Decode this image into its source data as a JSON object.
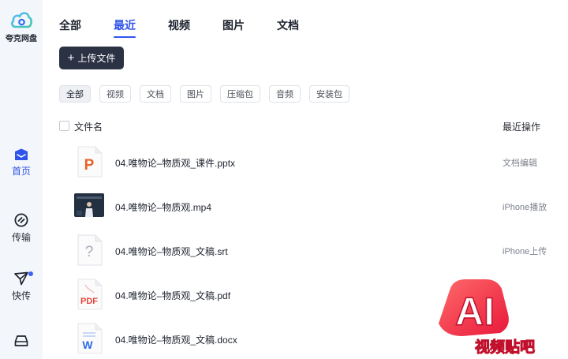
{
  "app": {
    "name": "夸克网盘"
  },
  "sidebar": {
    "items": [
      {
        "label": "首页",
        "icon": "home-icon",
        "active": true
      },
      {
        "label": "传输",
        "icon": "transfer-icon",
        "active": false
      },
      {
        "label": "快传",
        "icon": "send-icon",
        "active": false,
        "badge_dot": true
      },
      {
        "label": "",
        "icon": "inbox-icon",
        "active": false
      }
    ]
  },
  "tabs": [
    {
      "label": "全部",
      "active": false
    },
    {
      "label": "最近",
      "active": true
    },
    {
      "label": "视频",
      "active": false
    },
    {
      "label": "图片",
      "active": false
    },
    {
      "label": "文档",
      "active": false
    }
  ],
  "upload_button": {
    "label": "上传文件"
  },
  "filters": [
    {
      "label": "全部",
      "active": true
    },
    {
      "label": "视频",
      "active": false
    },
    {
      "label": "文档",
      "active": false
    },
    {
      "label": "图片",
      "active": false
    },
    {
      "label": "压缩包",
      "active": false
    },
    {
      "label": "音频",
      "active": false
    },
    {
      "label": "安装包",
      "active": false
    }
  ],
  "list": {
    "columns": {
      "name": "文件名",
      "recent_op": "最近操作"
    },
    "rows": [
      {
        "name": "04.唯物论–物质观_课件.pptx",
        "op": "文档编辑",
        "icon": "pptx-file-icon"
      },
      {
        "name": "04.唯物论–物质观.mp4",
        "op": "iPhone播放",
        "icon": "video-thumbnail"
      },
      {
        "name": "04.唯物论–物质观_文稿.srt",
        "op": "iPhone上传",
        "icon": "unknown-file-icon"
      },
      {
        "name": "04.唯物论–物质观_文稿.pdf",
        "op": "",
        "icon": "pdf-file-icon"
      },
      {
        "name": "04.唯物论–物质观_文稿.docx",
        "op": "",
        "icon": "docx-file-icon"
      }
    ]
  },
  "watermark": {
    "big": "AI",
    "small": "视频贴吧"
  },
  "colors": {
    "accent": "#2f54eb",
    "upload_bg": "#2b3244",
    "pptx": "#e8632b",
    "pdf": "#e2443a",
    "docx": "#2d6be6"
  }
}
